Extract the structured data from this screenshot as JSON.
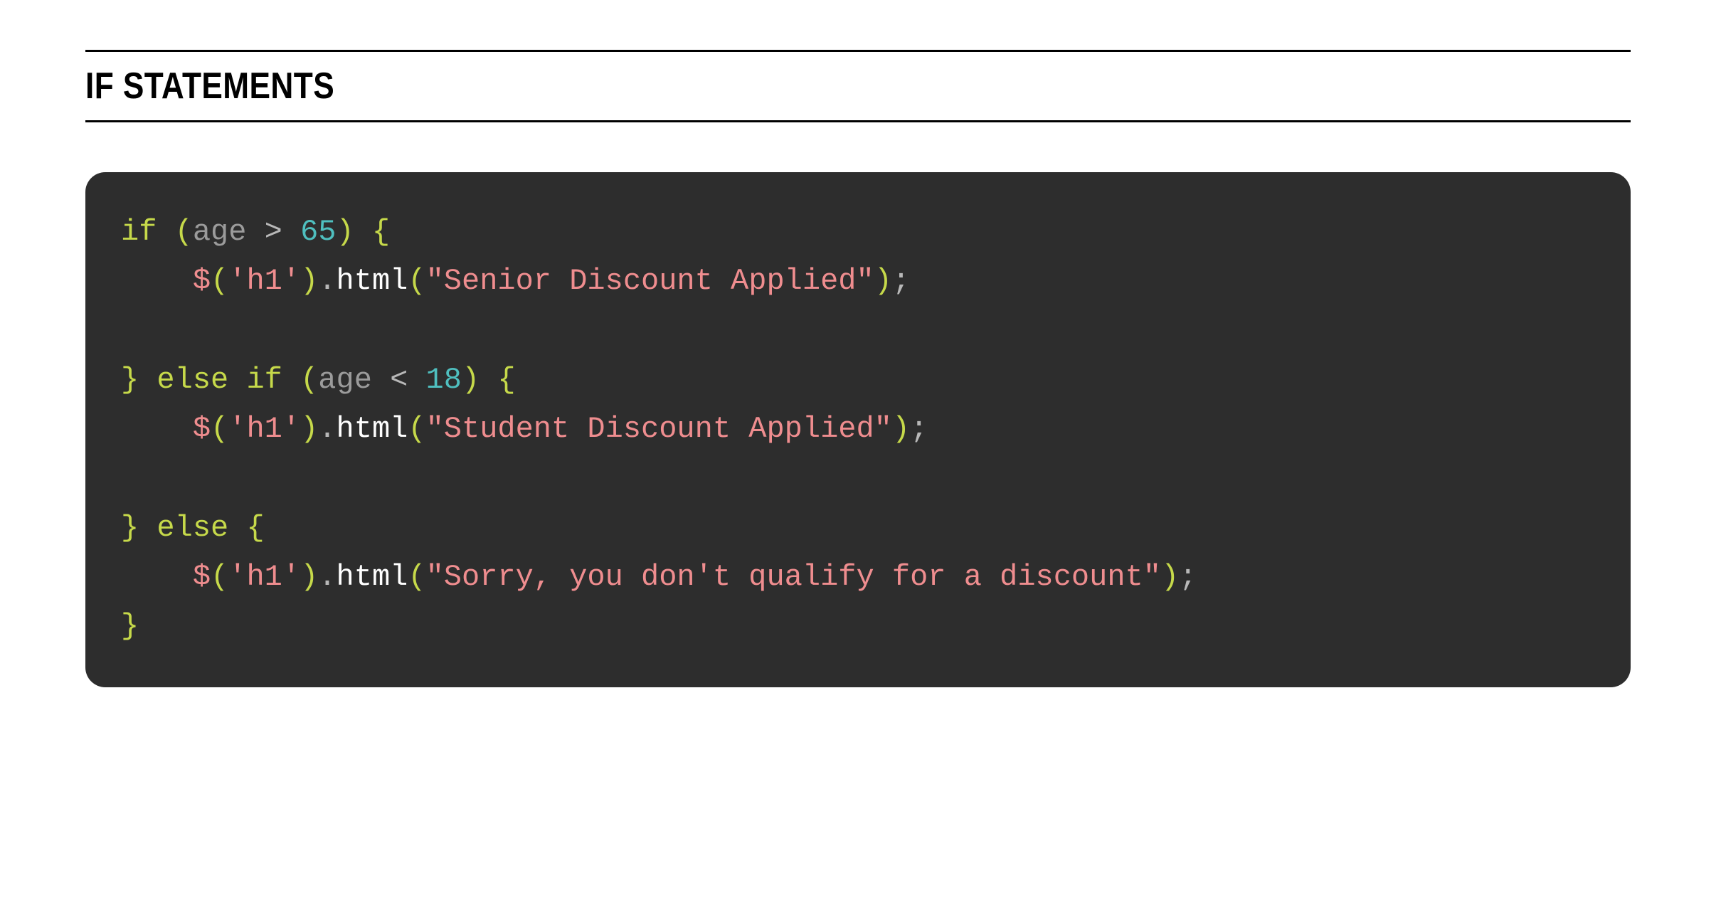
{
  "title": "IF STATEMENTS",
  "code": {
    "l1_if": "if",
    "l1_p1": " (",
    "l1_age": "age",
    "l1_op": " > ",
    "l1_num": "65",
    "l1_p2": ") {",
    "l2_indent": "    ",
    "l2_dollar": "$",
    "l2_p1": "(",
    "l2_sel": "'h1'",
    "l2_p2": ")",
    "l2_dot": ".",
    "l2_fn": "html",
    "l2_p3": "(",
    "l2_str": "\"Senior Discount Applied\"",
    "l2_p4": ")",
    "l2_semi": ";",
    "l4_close": "}",
    "l4_else": " else ",
    "l4_if": "if",
    "l4_p1": " (",
    "l4_age": "age",
    "l4_op": " < ",
    "l4_num": "18",
    "l4_p2": ") {",
    "l5_indent": "    ",
    "l5_dollar": "$",
    "l5_p1": "(",
    "l5_sel": "'h1'",
    "l5_p2": ")",
    "l5_dot": ".",
    "l5_fn": "html",
    "l5_p3": "(",
    "l5_str": "\"Student Discount Applied\"",
    "l5_p4": ")",
    "l5_semi": ";",
    "l7_close": "}",
    "l7_else": " else ",
    "l7_open": "{",
    "l8_indent": "    ",
    "l8_dollar": "$",
    "l8_p1": "(",
    "l8_sel": "'h1'",
    "l8_p2": ")",
    "l8_dot": ".",
    "l8_fn": "html",
    "l8_p3": "(",
    "l8_str": "\"Sorry, you don't qualify for a discount\"",
    "l8_p4": ")",
    "l8_semi": ";",
    "l9_close": "}"
  }
}
